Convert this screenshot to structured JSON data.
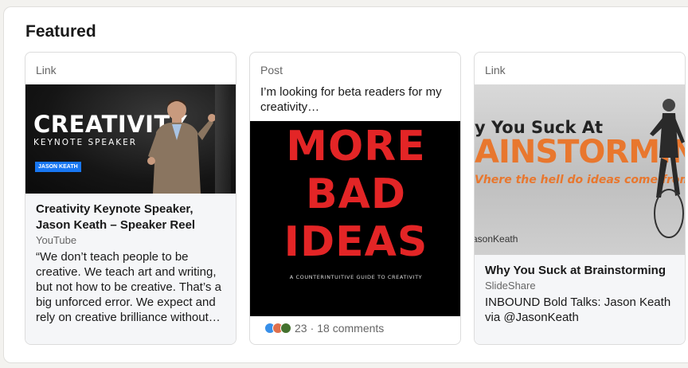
{
  "section": {
    "title": "Featured"
  },
  "cards": [
    {
      "type_label": "Link",
      "image": {
        "headline": "CREATIVITY",
        "subline": "KEYNOTE SPEAKER",
        "name_tag": "JASON KEATH"
      },
      "title": "Creativity Keynote Speaker, Jason Keath – Speaker Reel",
      "source": "YouTube",
      "description": "“We don’t teach people to be creative. We teach art and writing, but not how to be creative. That’s a big unforced error. We expect and rely on creative brilliance without…"
    },
    {
      "type_label": "Post",
      "text": "I’m looking for beta readers for my creativity…",
      "image": {
        "line1": "MORE",
        "line2": "BAD",
        "line3": "IDEAS",
        "tagline": "A COUNTERINTUITIVE GUIDE TO CREATIVITY"
      },
      "reactions": {
        "icons": [
          "like-icon",
          "love-icon",
          "celebrate-icon"
        ],
        "count": "23",
        "separator": "·",
        "comments": "18 comments"
      }
    },
    {
      "type_label": "Link",
      "image": {
        "line1": "y You Suck At",
        "line2": "AINSTORMING",
        "line3": "Vhere the hell do ideas come from?",
        "handle": "asonKeath"
      },
      "title": "Why You Suck at Brainstorming",
      "source": "SlideShare",
      "description": "INBOUND Bold Talks: Jason Keath",
      "via": "via @JasonKeath"
    }
  ],
  "colors": {
    "accent_blue": "#1877f2",
    "book_red": "#e32526",
    "slide_orange": "#e8772e"
  }
}
